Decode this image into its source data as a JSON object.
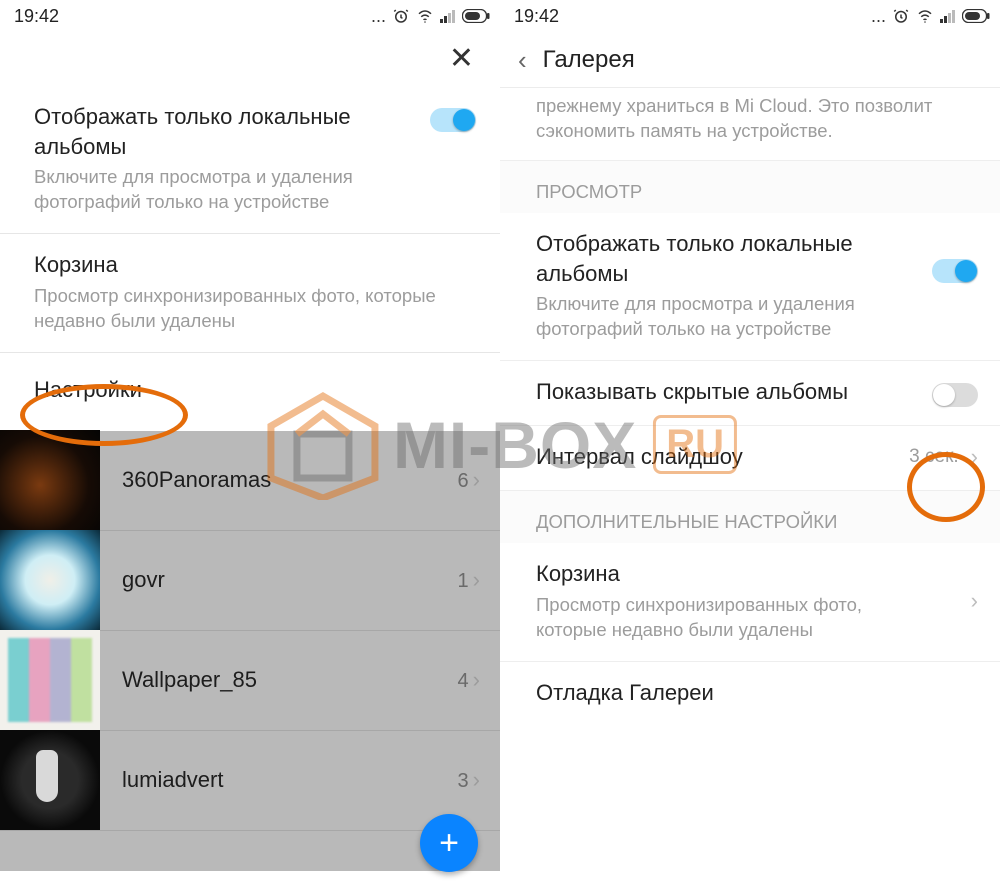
{
  "status": {
    "time": "19:42",
    "dots": "..."
  },
  "left": {
    "close": "✕",
    "local_albums": {
      "title": "Отображать только локальные альбомы",
      "sub": "Включите для просмотра и удаления фотографий только на устройстве"
    },
    "trash": {
      "title": "Корзина",
      "sub": "Просмотр синхронизированных фото, которые недавно были удалены"
    },
    "settings_label": "Настройки",
    "albums": [
      {
        "name": "360Panoramas",
        "count": "6"
      },
      {
        "name": "govr",
        "count": "1"
      },
      {
        "name": "Wallpaper_85",
        "count": "4"
      },
      {
        "name": "lumiadvert",
        "count": "3"
      }
    ],
    "fab": "+"
  },
  "right": {
    "nav_title": "Галерея",
    "cloud_tail": "прежнему храниться в Mi Cloud. Это позволит сэкономить память на устройстве.",
    "section_view": "ПРОСМОТР",
    "local_albums": {
      "title": "Отображать только локальные альбомы",
      "sub": "Включите для просмотра и удаления фотографий только на устройстве"
    },
    "hidden_albums": {
      "title": "Показывать скрытые альбомы"
    },
    "slideshow": {
      "title": "Интервал слайдшоу",
      "value": "3 сек."
    },
    "section_extra": "ДОПОЛНИТЕЛЬНЫЕ НАСТРОЙКИ",
    "trash": {
      "title": "Корзина",
      "sub": "Просмотр синхронизированных фото, которые недавно были удалены"
    },
    "debug": "Отладка Галереи"
  },
  "watermark": {
    "main": "MI-BOX",
    "suffix": "RU"
  }
}
